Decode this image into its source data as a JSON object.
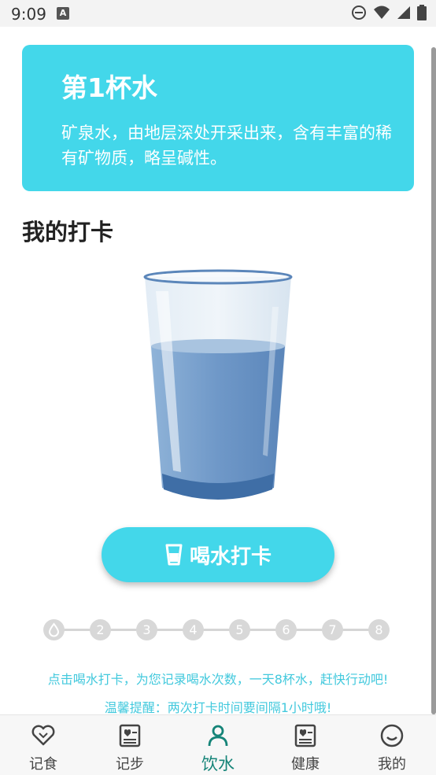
{
  "status_bar": {
    "time": "9:09"
  },
  "card": {
    "title": "第1杯水",
    "description": "矿泉水，由地层深处开采出来，含有丰富的稀有矿物质，略呈碱性。"
  },
  "section": {
    "title": "我的打卡"
  },
  "checkin_button": {
    "label": "喝水打卡"
  },
  "progress": {
    "steps": [
      "",
      "2",
      "3",
      "4",
      "5",
      "6",
      "7",
      "8"
    ],
    "completed": 0
  },
  "hints": {
    "line1": "点击喝水打卡，为您记录喝水次数，一天8杯水，赶快行动吧!",
    "line2": "温馨提醒：两次打卡时间要间隔1小时哦!"
  },
  "nav": {
    "items": [
      {
        "label": "记食",
        "icon": "heart-icon"
      },
      {
        "label": "记步",
        "icon": "notebook-icon"
      },
      {
        "label": "饮水",
        "icon": "person-icon",
        "active": true
      },
      {
        "label": "健康",
        "icon": "notebook-icon"
      },
      {
        "label": "我的",
        "icon": "smile-icon"
      }
    ]
  },
  "colors": {
    "accent": "#43d7ea",
    "active_nav": "#158478",
    "hint": "#43c9dd"
  }
}
